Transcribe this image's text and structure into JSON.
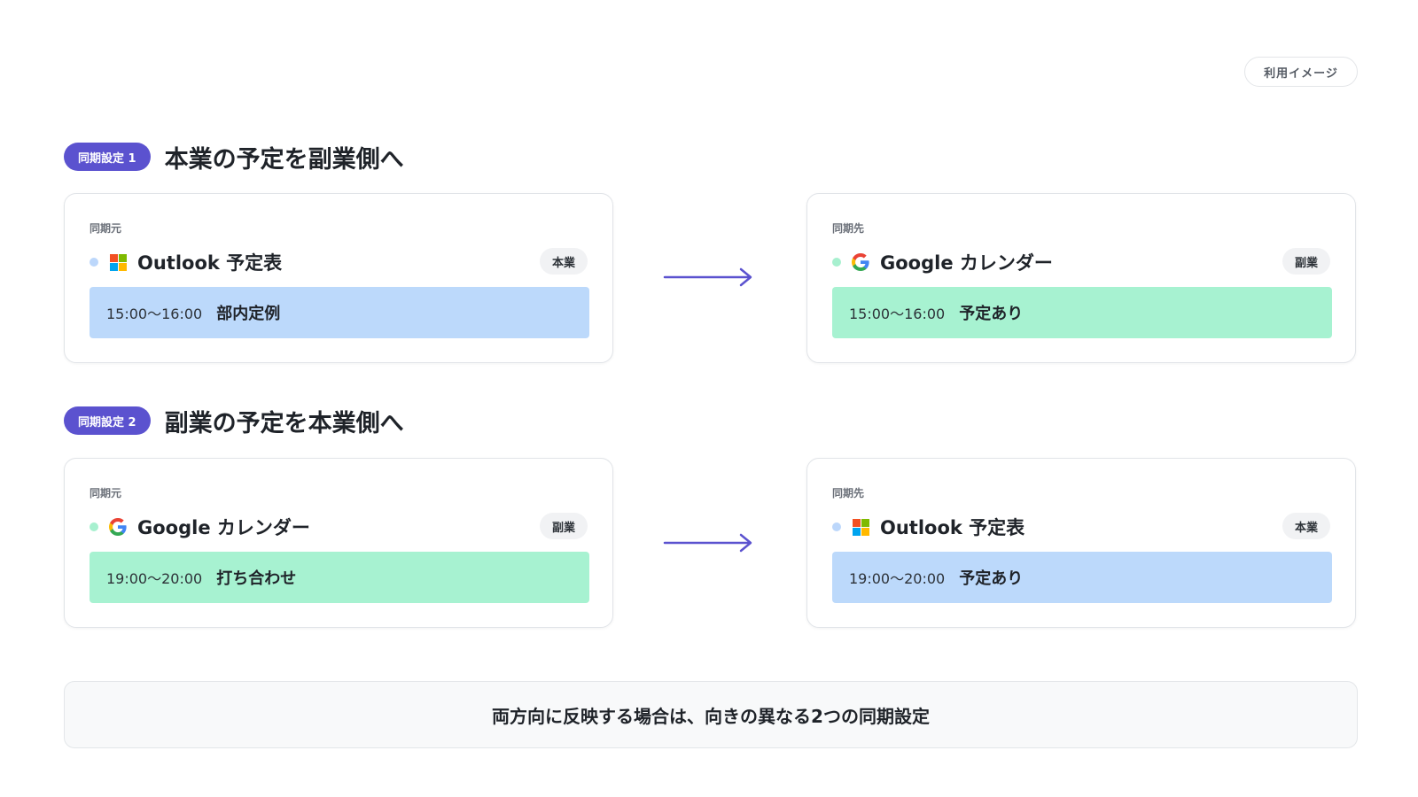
{
  "usage_tag": "利用イメージ",
  "colors": {
    "accent": "#5b52cf",
    "outlook_dot": "#bcd7fb",
    "google_dot": "#a7f0cf",
    "outlook_event_bg": "#bcd9fb",
    "google_event_bg": "#a7f2d1",
    "arrow": "#5b52cf"
  },
  "sections": [
    {
      "pill": "同期設定 1",
      "title": "本業の予定を副業側へ",
      "source": {
        "label": "同期元",
        "calendar": "Outlook 予定表",
        "icon": "microsoft-icon",
        "role": "本業",
        "event_time": "15:00〜16:00",
        "event_title": "部内定例"
      },
      "target": {
        "label": "同期先",
        "calendar": "Google カレンダー",
        "icon": "google-icon",
        "role": "副業",
        "event_time": "15:00〜16:00",
        "event_title": "予定あり"
      }
    },
    {
      "pill": "同期設定 2",
      "title": "副業の予定を本業側へ",
      "source": {
        "label": "同期元",
        "calendar": "Google カレンダー",
        "icon": "google-icon",
        "role": "副業",
        "event_time": "19:00〜20:00",
        "event_title": "打ち合わせ"
      },
      "target": {
        "label": "同期先",
        "calendar": "Outlook 予定表",
        "icon": "microsoft-icon",
        "role": "本業",
        "event_time": "19:00〜20:00",
        "event_title": "予定あり"
      }
    }
  ],
  "summary": "両方向に反映する場合は、向きの異なる2つの同期設定"
}
